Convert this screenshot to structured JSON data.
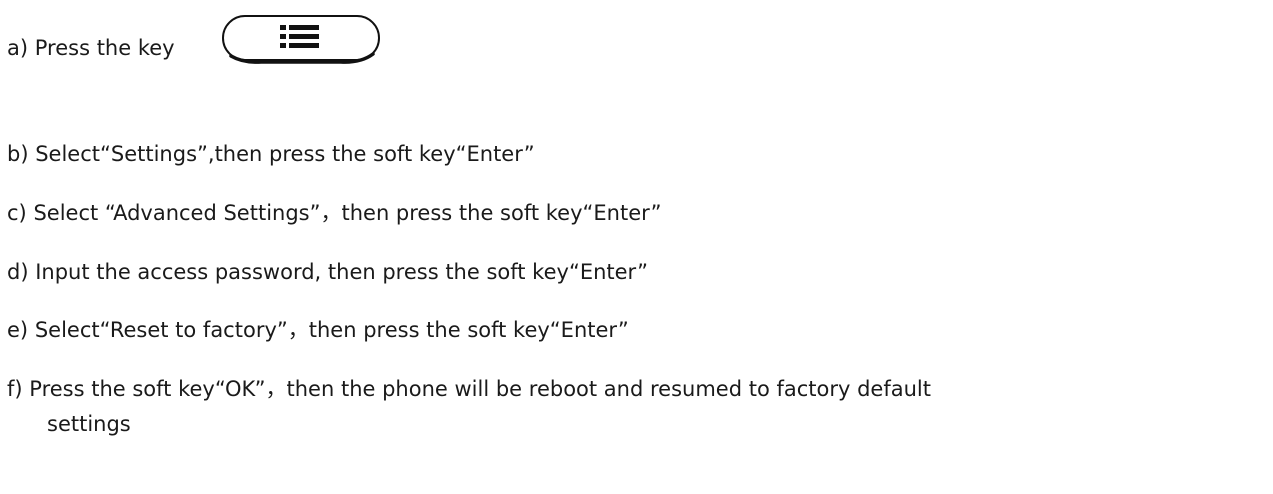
{
  "steps": [
    {
      "marker": "a)",
      "text": "Press the key"
    },
    {
      "marker": "b)",
      "text": "Select“Settings”,then press the soft key“Enter”"
    },
    {
      "marker": "c)",
      "text": "Select “Advanced Settings”，then press the soft key“Enter”"
    },
    {
      "marker": "d)",
      "text": "Input the access password, then press the soft key“Enter”"
    },
    {
      "marker": "e)",
      "text": "Select“Reset to factory”，then press the soft key“Enter”"
    },
    {
      "marker": "f)",
      "text": "Press the soft key“OK”，then the phone will be reboot and resumed to factory default",
      "continuation": "settings"
    }
  ],
  "key_icon": "menu-list-icon"
}
